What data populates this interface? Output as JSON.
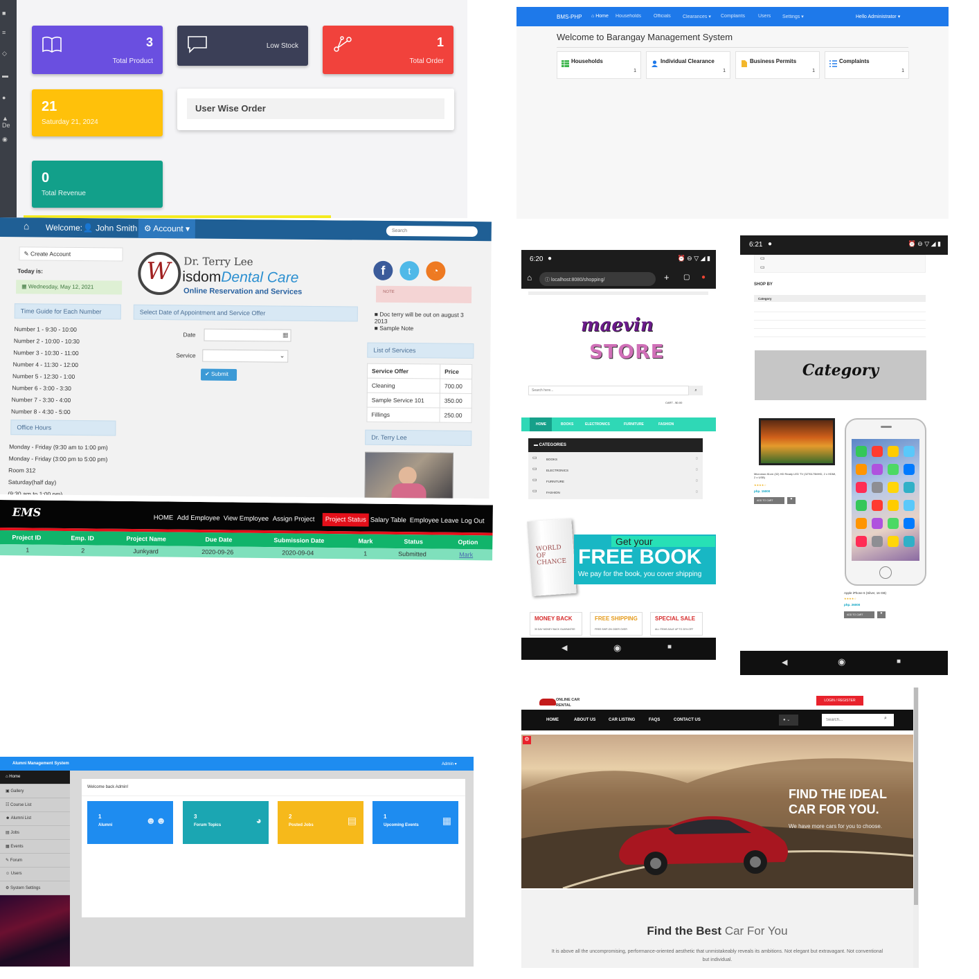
{
  "inventory": {
    "cards": [
      {
        "value": "3",
        "label": "Total Product",
        "color": "#6a4fe0"
      },
      {
        "value": "",
        "label": "Low Stock",
        "color": "#3b3f57"
      },
      {
        "value": "1",
        "label": "Total Order",
        "color": "#f1423c"
      }
    ],
    "date_card": {
      "value": "21",
      "label": "Saturday 21, 2024",
      "color": "#ffc10a"
    },
    "user_wise": "User Wise Order",
    "revenue": {
      "value": "0",
      "label": "Total Revenue",
      "color": "#12a08a"
    },
    "rail_text": "De"
  },
  "bms": {
    "brand": "BMS-PHP",
    "nav": [
      "Home",
      "Households",
      "Officials",
      "Clearances ▾",
      "Complaints",
      "Users",
      "Settings ▾"
    ],
    "user": "Hello Administrator ▾",
    "welcome": "Welcome to Barangay Management System",
    "cards": [
      {
        "title": "Households",
        "count": "1"
      },
      {
        "title": "Individual Clearance",
        "count": "1"
      },
      {
        "title": "Business Permits",
        "count": "1"
      },
      {
        "title": "Complaints",
        "count": "1"
      }
    ]
  },
  "dental": {
    "welcome": "Welcome:",
    "user": "John Smith",
    "account": "Account ▾",
    "search_placeholder": "Search",
    "create_account": "Create Account",
    "today_label": "Today is:",
    "today": "Wednesday, May 12, 2021",
    "time_guide": "Time Guide for Each Number",
    "numbers": [
      "Number 1 - 9:30 - 10:00",
      "Number 2 - 10:00 - 10:30",
      "Number 3 - 10:30 - 11:00",
      "Number 4 - 11:30 - 12:00",
      "Number 5 - 12:30 - 1:00",
      "Number 6 - 3:00 - 3:30",
      "Number 7 - 3:30 - 4:00",
      "Number 8 - 4:30 - 5:00"
    ],
    "office_hours": "Office Hours",
    "hours": [
      "Monday - Friday (9:30 am to 1:00 pm)",
      "Monday - Friday (3:00 pm to 5:00 pm)",
      "Room 312",
      "Saturday(half day)",
      "(9:30 am to 1:00 pm)"
    ],
    "doctor": "Dr. Terry Lee",
    "brand_a": "isdom",
    "brand_b": "Dental Care",
    "tagline": "Online Reservation and Services",
    "select_prompt": "Select Date of Appointment and Service Offer",
    "date_label": "Date",
    "service_label": "Service",
    "submit": "Submit",
    "note": "NOTE",
    "notes": [
      "Doc terry will be out on august 3 2013",
      "Sample Note"
    ],
    "services_title": "List of Services",
    "services_head": [
      "Service Offer",
      "Price"
    ],
    "services": [
      [
        "Cleaning",
        "700.00"
      ],
      [
        "Sample Service 101",
        "350.00"
      ],
      [
        "Fillings",
        "250.00"
      ]
    ],
    "doctor_box": "Dr. Terry Lee"
  },
  "ems": {
    "logo": "EMS",
    "nav": [
      "HOME",
      "Add Employee",
      "View Employee",
      "Assign Project",
      "Project Status",
      "Salary Table",
      "Employee Leave",
      "Log Out"
    ],
    "head": [
      "Project ID",
      "Emp. ID",
      "Project Name",
      "Due Date",
      "Submission Date",
      "Mark",
      "Status",
      "Option"
    ],
    "row": [
      "1",
      "2",
      "Junkyard",
      "2020-09-26",
      "2020-09-04",
      "1",
      "Submitted",
      "Mark"
    ]
  },
  "store": {
    "time": "6:20",
    "url": "localhost:8080/shopping/",
    "brand_a": "maevin",
    "brand_b": "STORE",
    "search_placeholder": "Search here...",
    "cart": "CART - $0.00",
    "menu": [
      "HOME",
      "BOOKS",
      "ELECTRONICS",
      "FURNITURE",
      "FASHION"
    ],
    "categories_title": "CATEGORIES",
    "categories": [
      "BOOKS",
      "ELECTRONICS",
      "FURNITURE",
      "FASHION"
    ],
    "book_title": "WORLD OF CHANCE",
    "banner_a": "Get your",
    "banner_b": "FREE BOOK",
    "banner_c": "We pay for the book, you cover shipping",
    "features": [
      {
        "title": "MONEY BACK",
        "sub": "30 DAY MONEY BACK GUARANTEE"
      },
      {
        "title": "FREE SHIPPING",
        "sub": "FREE SHIP-ON ODER OVER"
      },
      {
        "title": "SPECIAL SALE",
        "sub": "ALL ITEMS-SALE UP TO 20% OFF"
      }
    ]
  },
  "store2": {
    "time": "6:21",
    "shop_by": "SHOP BY",
    "category_head": "Category",
    "category_banner": "Category",
    "products": [
      {
        "name": "Micromax 81cm (32) HD Ready LED TV (32T6175MHD, 2 x HDMI, 2 x USB)",
        "price": "php. 15000"
      },
      {
        "name": "Apple iPhone 6 (Silver, 16 GB)",
        "price": "php. 26000"
      }
    ],
    "add_to_cart": "ADD TO CART"
  },
  "car": {
    "logo": "ONLINE CAR RENTAL",
    "login": "LOGIN / REGISTER",
    "menu": [
      "HOME",
      "ABOUT US",
      "CAR LISTING",
      "FAQS",
      "CONTACT US"
    ],
    "search_placeholder": "Search...",
    "hero_a": "FIND THE IDEAL",
    "hero_b": "CAR FOR YOU.",
    "hero_c": "We have more cars for you to choose.",
    "find_a": "Find the Best",
    "find_b": "Car For You",
    "desc": "It is above all the uncompromising, performance-oriented aesthetic that unmistakeably reveals its ambitions. Not elegant but extravagant. Not conventional but individual."
  },
  "alumni": {
    "title": "Alumni Management System",
    "admin": "Admin ▾",
    "menu": [
      "Home",
      "Gallery",
      "Course List",
      "Alumni List",
      "Jobs",
      "Events",
      "Forum",
      "Users",
      "System Settings"
    ],
    "welcome": "Welcome back Admin!",
    "cards": [
      {
        "n": "1",
        "l": "Alumni",
        "color": "#1e8cf0"
      },
      {
        "n": "3",
        "l": "Forum Topics",
        "color": "#1ba6b2"
      },
      {
        "n": "2",
        "l": "Posted Jobs",
        "color": "#f6b91b"
      },
      {
        "n": "1",
        "l": "Upcoming Events",
        "color": "#1e8cf0"
      }
    ]
  }
}
